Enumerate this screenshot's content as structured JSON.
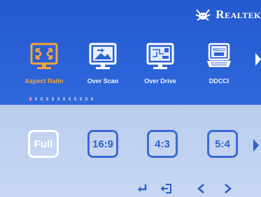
{
  "brand": {
    "logo_icon": "realtek-crab-logo-icon",
    "name": "Realtek"
  },
  "menu": {
    "items": [
      {
        "label": "Aspect Ratio",
        "icon": "aspect-ratio-icon",
        "active": true
      },
      {
        "label": "Over Scan",
        "icon": "over-scan-icon",
        "active": false
      },
      {
        "label": "Over Drive",
        "icon": "over-drive-icon",
        "active": false
      },
      {
        "label": "DDCCI",
        "icon": "ddcci-icon",
        "active": false
      }
    ],
    "more_icon": "triangle-right-icon"
  },
  "progress": {
    "segments": 12,
    "current": 1
  },
  "options": {
    "items": [
      "Full",
      "16:9",
      "4:3",
      "5:4"
    ],
    "selected": "Full",
    "more_icon": "triangle-right-icon"
  },
  "navigation": {
    "icons": [
      "enter-icon",
      "exit-icon",
      "chevron-left-icon",
      "chevron-right-icon"
    ]
  },
  "colors": {
    "top_panel": "#2a63d6",
    "bottom_panel": "#c3d4f1",
    "accent_active": "#f2a43a",
    "option_border": "#3a6bd8"
  }
}
